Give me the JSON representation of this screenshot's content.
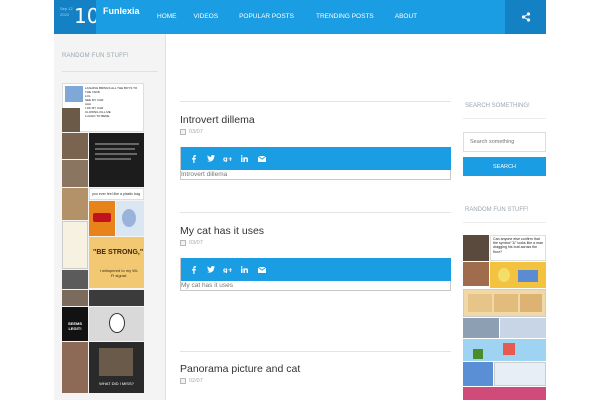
{
  "header": {
    "logo_date": "Sep 12 2023",
    "logo_day": "10",
    "brand": "Funlexia",
    "nav": [
      {
        "label": "HOME"
      },
      {
        "label": "VIDEOS"
      },
      {
        "label": "POPULAR POSTS"
      },
      {
        "label": "TRENDING POSTS"
      },
      {
        "label": "ABOUT"
      }
    ],
    "share_icon": "share-icon",
    "colors": {
      "bar": "#1a9de2",
      "dark": "#1381c4"
    }
  },
  "left_sidebar": {
    "title": "RANDOM FUN STUFF!",
    "thumb_texts": {
      "lasagna": "LASHING BRINGS ALL THE BOYS TO THE YARD\nLOL\nSEE MY CAR\nAAA\nI JIF MY CAR\nCLOWNG KILL ME\nLUAGO TO BEDE",
      "plastic_bag": "you ever feel like a plastic bag",
      "be_strong": "\"BE STRONG,\"",
      "whispered": "I whispered to my Wi-Fi signal:",
      "seems_legit": "SEEMS LEGIT!",
      "what_did_i_miss": "WHAT DID I MISS?"
    }
  },
  "posts": [
    {
      "title": "Introvert dillema",
      "date": "03/07",
      "excerpt": "Introvert dillema"
    },
    {
      "title": "My cat has it uses",
      "date": "03/07",
      "excerpt": "My cat has it uses"
    },
    {
      "title": "Panorama picture and cat",
      "date": "02/07"
    }
  ],
  "share_icons": [
    "facebook-icon",
    "twitter-icon",
    "google-plus-icon",
    "linkedin-icon",
    "email-icon"
  ],
  "right_sidebar": {
    "search_title": "SEARCH SOMETHING!",
    "search_placeholder": "Search something",
    "search_button": "SEARCH",
    "random_title": "RANDOM FUN STUFF!",
    "thumb_text": "Can anyone else confirm that the symbol \"&\" looks like a man dragging his butt across the floor?"
  }
}
